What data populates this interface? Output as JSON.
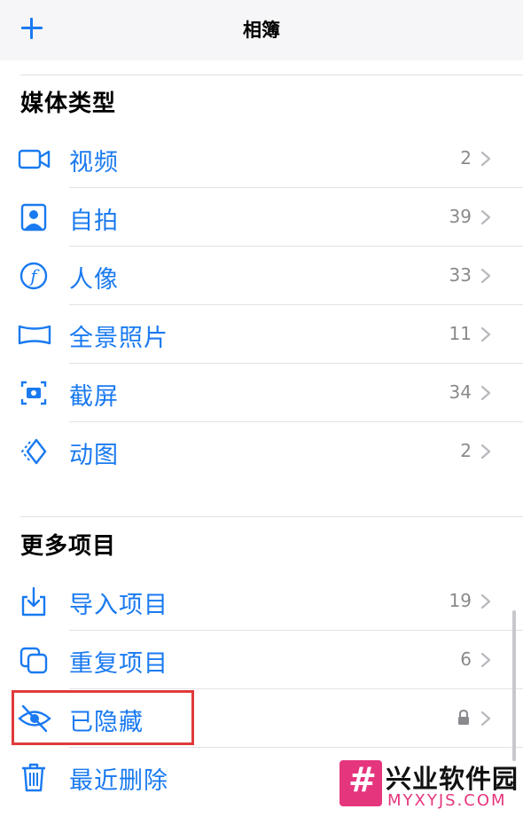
{
  "navbar": {
    "add_icon": "plus-icon",
    "title": "相簿"
  },
  "sections": {
    "media_types": {
      "title": "媒体类型"
    },
    "more_items": {
      "title": "更多项目"
    }
  },
  "rows": [
    {
      "label": "视频",
      "count": "2",
      "icon": "video-icon"
    },
    {
      "label": "自拍",
      "count": "39",
      "icon": "selfie-icon"
    },
    {
      "label": "人像",
      "count": "33",
      "icon": "portrait-icon"
    },
    {
      "label": "全景照片",
      "count": "11",
      "icon": "panorama-icon"
    },
    {
      "label": "截屏",
      "count": "34",
      "icon": "screenshot-icon"
    },
    {
      "label": "动图",
      "count": "2",
      "icon": "animated-icon"
    },
    {
      "label": "导入项目",
      "count": "19",
      "icon": "import-icon"
    },
    {
      "label": "重复项目",
      "count": "6",
      "icon": "duplicate-icon"
    },
    {
      "label": "已隐藏",
      "count": "",
      "icon": "hidden-eye-icon",
      "locked": true
    },
    {
      "label": "最近删除",
      "count": "",
      "icon": "trash-icon"
    }
  ],
  "colors": {
    "accent": "#1a7af0",
    "highlight": "#e03b3b",
    "watermark": "#e5357d"
  },
  "watermark": {
    "title": "兴业软件园",
    "subtitle": "MYXYJS.COM",
    "logo_glyph": "#"
  }
}
